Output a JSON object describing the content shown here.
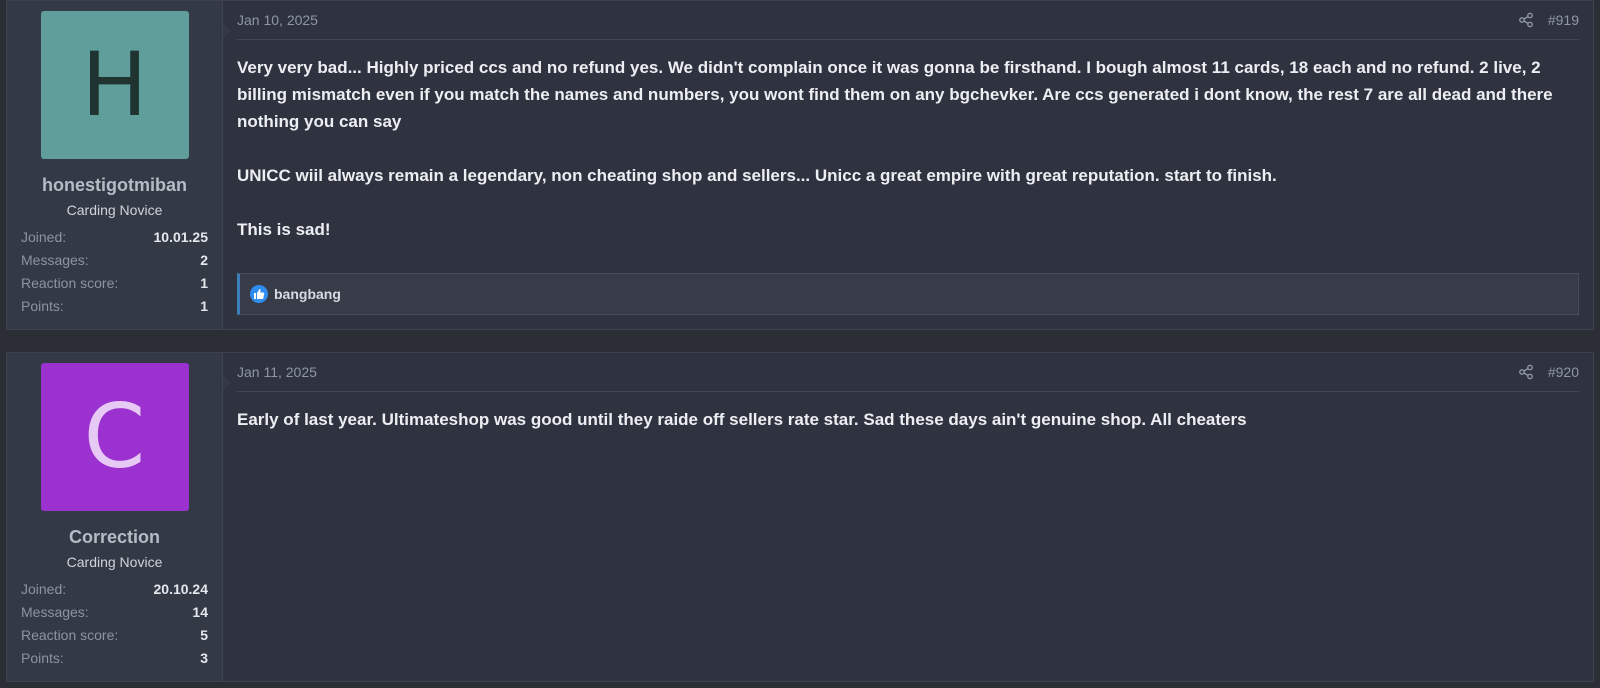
{
  "posts": [
    {
      "avatar_letter": "H",
      "avatar_bg": "#5f9e9a",
      "avatar_fg": "#1f3330",
      "username": "honestigotmiban",
      "user_title": "Carding Novice",
      "stats": [
        {
          "label": "Joined:",
          "value": "10.01.25"
        },
        {
          "label": "Messages:",
          "value": "2"
        },
        {
          "label": "Reaction score:",
          "value": "1"
        },
        {
          "label": "Points:",
          "value": "1"
        }
      ],
      "date": "Jan 10, 2025",
      "post_number": "#919",
      "paragraphs": [
        "Very very bad... Highly priced ccs and no refund yes. We didn't complain once it was gonna be firsthand. I bough almost 11 cards, 18 each and no refund. 2 live, 2 billing mismatch even if you match the names and numbers, you wont find them on any bgchevker. Are ccs generated i dont know, the rest 7 are all dead and there nothing you can say",
        "UNICC wiil always remain a legendary, non cheating shop and sellers... Unicc a great empire with great reputation. start to finish.",
        "This is sad!"
      ],
      "reaction_user": "bangbang",
      "reaction_icon": "thumbs-up-icon"
    },
    {
      "avatar_letter": "C",
      "avatar_bg": "#9b31cf",
      "avatar_fg": "#e7c9f5",
      "username": "Correction",
      "user_title": "Carding Novice",
      "stats": [
        {
          "label": "Joined:",
          "value": "20.10.24"
        },
        {
          "label": "Messages:",
          "value": "14"
        },
        {
          "label": "Reaction score:",
          "value": "5"
        },
        {
          "label": "Points:",
          "value": "3"
        }
      ],
      "date": "Jan 11, 2025",
      "post_number": "#920",
      "paragraphs": [
        "Early of last year. Ultimateshop was good until they raide off sellers rate star. Sad these days ain't genuine shop. All cheaters"
      ]
    }
  ],
  "icons": {
    "share": "share-icon"
  }
}
